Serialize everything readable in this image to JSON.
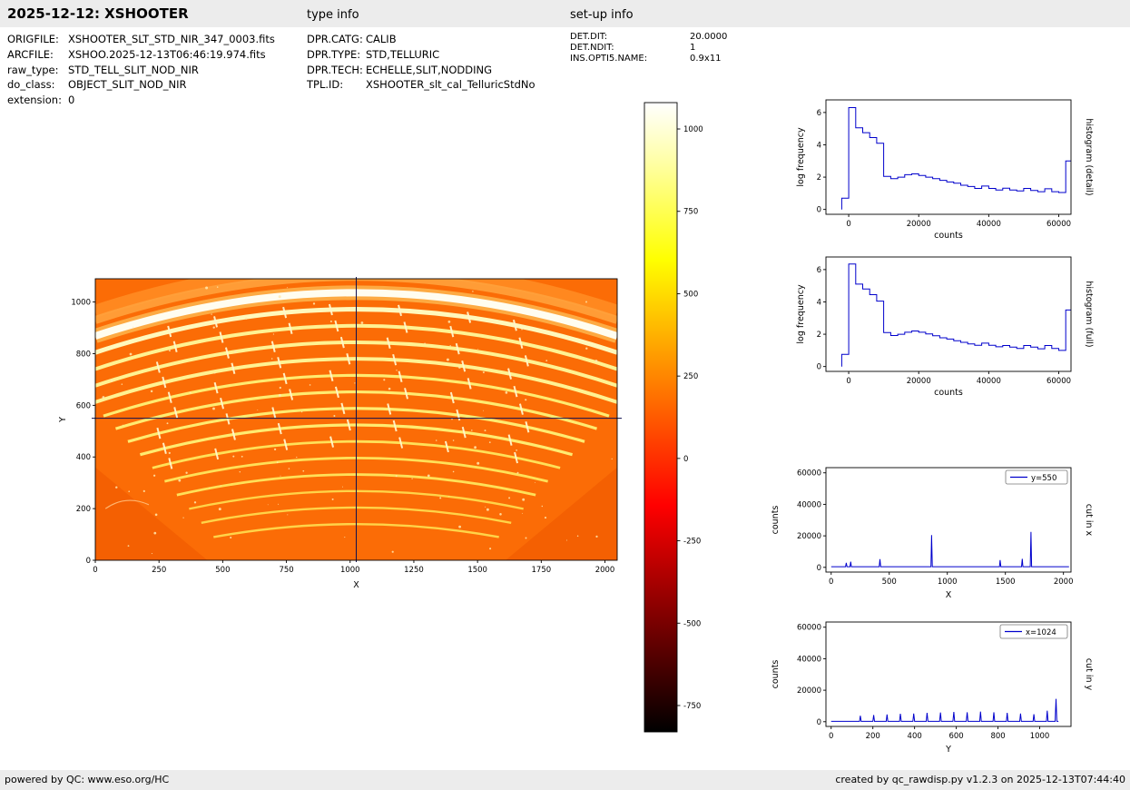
{
  "header": {
    "title": "2025-12-12: XSHOOTER",
    "type_info_label": "type info",
    "setup_info_label": "set-up info"
  },
  "file_info": [
    {
      "key": "ORIGFILE:",
      "value": "XSHOOTER_SLT_STD_NIR_347_0003.fits"
    },
    {
      "key": "ARCFILE:",
      "value": "XSHOO.2025-12-13T06:46:19.974.fits"
    },
    {
      "key": "raw_type:",
      "value": "STD_TELL_SLIT_NOD_NIR"
    },
    {
      "key": "do_class:",
      "value": "OBJECT_SLIT_NOD_NIR"
    },
    {
      "key": "extension:",
      "value": "0"
    }
  ],
  "type_info": [
    {
      "key": "DPR.CATG:",
      "value": "CALIB"
    },
    {
      "key": "DPR.TYPE:",
      "value": "STD,TELLURIC"
    },
    {
      "key": "DPR.TECH:",
      "value": "ECHELLE,SLIT,NODDING"
    },
    {
      "key": "TPL.ID:",
      "value": "XSHOOTER_slt_cal_TelluricStdNo"
    }
  ],
  "setup_info": [
    {
      "key": "DET.DIT:",
      "value": "20.0000"
    },
    {
      "key": "DET.NDIT:",
      "value": "1"
    },
    {
      "key": "INS.OPTI5.NAME:",
      "value": "0.9x11"
    }
  ],
  "footer": {
    "left": "powered by QC: www.eso.org/HC",
    "right": "created by qc_rawdisp.py v1.2.3 on 2025-12-13T07:44:40"
  },
  "chart_data": [
    {
      "id": "raw_frame",
      "type": "heatmap",
      "description": "XSHOOTER NIR raw echelle frame: ~15 bright curved spectral orders on orange background, hot colormap, crosshair marking cut positions",
      "xlabel": "X",
      "ylabel": "Y",
      "xlim": [
        0,
        2048
      ],
      "ylim": [
        0,
        1090
      ],
      "xticks": [
        0,
        250,
        500,
        750,
        1000,
        1250,
        1500,
        1750,
        2000
      ],
      "yticks": [
        0,
        200,
        400,
        600,
        800,
        1000
      ],
      "colormap": "hot",
      "crosshair": {
        "x": 1024,
        "y": 550
      },
      "image": {
        "background": "#fb6c06",
        "corner_shade": "#f05a00",
        "orders": {
          "count": 15,
          "peak_y_start": 140,
          "peak_y_step": 64,
          "halfspan_start": 560,
          "halfspan_step": 48,
          "curvature": 0.00016
        }
      },
      "colorbar": {
        "ticks": [
          1000,
          750,
          500,
          250,
          0,
          -250,
          -500,
          -750
        ],
        "vmin": -830,
        "vmax": 1080,
        "gradient_top_to_bottom": [
          [
            "0%",
            "#ffffff"
          ],
          [
            "10%",
            "#ffffa0"
          ],
          [
            "25%",
            "#ffff00"
          ],
          [
            "45%",
            "#ff7c00"
          ],
          [
            "55%",
            "#ff3900"
          ],
          [
            "64%",
            "#ff0000"
          ],
          [
            "80%",
            "#8c0000"
          ],
          [
            "92%",
            "#380000"
          ],
          [
            "100%",
            "#000000"
          ]
        ]
      }
    },
    {
      "id": "hist_detail",
      "type": "line",
      "subtype": "step-histogram",
      "xlabel": "counts",
      "ylabel": "log frequency",
      "right_label": "histogram (detail)",
      "xlim": [
        -6500,
        63500
      ],
      "ylim": [
        -0.3,
        6.78
      ],
      "xticks": [
        0,
        20000,
        40000,
        60000
      ],
      "yticks": [
        0,
        2,
        4,
        6
      ],
      "line_color": "#0000cc",
      "bin_start": -2000,
      "bin_width": 2000,
      "values": [
        0.7,
        6.3,
        5.05,
        4.75,
        4.45,
        4.1,
        2.05,
        1.9,
        2.0,
        2.15,
        2.2,
        2.1,
        2.0,
        1.9,
        1.8,
        1.7,
        1.62,
        1.5,
        1.42,
        1.3,
        1.45,
        1.3,
        1.2,
        1.32,
        1.2,
        1.15,
        1.3,
        1.18,
        1.1,
        1.28,
        1.1,
        1.05,
        3.0
      ]
    },
    {
      "id": "hist_full",
      "type": "line",
      "subtype": "step-histogram",
      "xlabel": "counts",
      "ylabel": "log frequency",
      "right_label": "histogram (full)",
      "xlim": [
        -6500,
        63500
      ],
      "ylim": [
        -0.3,
        6.78
      ],
      "xticks": [
        0,
        20000,
        40000,
        60000
      ],
      "yticks": [
        0,
        2,
        4,
        6
      ],
      "line_color": "#0000cc",
      "bin_start": -2000,
      "bin_width": 2000,
      "values": [
        0.75,
        6.35,
        5.1,
        4.8,
        4.45,
        4.05,
        2.1,
        1.92,
        2.0,
        2.12,
        2.2,
        2.12,
        2.02,
        1.9,
        1.78,
        1.7,
        1.6,
        1.5,
        1.4,
        1.32,
        1.45,
        1.32,
        1.22,
        1.3,
        1.2,
        1.12,
        1.3,
        1.2,
        1.1,
        1.3,
        1.12,
        1.0,
        3.5
      ]
    },
    {
      "id": "cut_x",
      "type": "line",
      "subtype": "spikes",
      "legend": "y=550",
      "xlabel": "X",
      "ylabel": "counts",
      "right_label": "cut in x",
      "xlim": [
        -45,
        2065
      ],
      "ylim": [
        -3000,
        63300
      ],
      "xticks": [
        0,
        500,
        1000,
        1500,
        2000
      ],
      "yticks": [
        0,
        20000,
        40000,
        60000
      ],
      "line_color": "#0000cc",
      "baseline": 400,
      "xrange": [
        0,
        2048
      ],
      "spike_halfwidth": 6,
      "spikes": [
        [
          130,
          2800
        ],
        [
          168,
          3600
        ],
        [
          420,
          5200
        ],
        [
          865,
          20500
        ],
        [
          1455,
          4600
        ],
        [
          1645,
          5400
        ],
        [
          1720,
          22500
        ]
      ]
    },
    {
      "id": "cut_y",
      "type": "line",
      "subtype": "spikes",
      "legend": "x=1024",
      "xlabel": "Y",
      "ylabel": "counts",
      "right_label": "cut in y",
      "xlim": [
        -25,
        1150
      ],
      "ylim": [
        -3000,
        63300
      ],
      "xticks": [
        0,
        200,
        400,
        600,
        800,
        1000
      ],
      "yticks": [
        0,
        20000,
        40000,
        60000
      ],
      "line_color": "#0000cc",
      "baseline": 250,
      "xrange": [
        0,
        1090
      ],
      "spike_halfwidth": 4,
      "spikes": [
        [
          140,
          3800
        ],
        [
          204,
          4200
        ],
        [
          268,
          4600
        ],
        [
          332,
          5000
        ],
        [
          396,
          5200
        ],
        [
          460,
          5600
        ],
        [
          524,
          5800
        ],
        [
          588,
          6200
        ],
        [
          652,
          6000
        ],
        [
          716,
          6400
        ],
        [
          780,
          6000
        ],
        [
          844,
          5600
        ],
        [
          908,
          5200
        ],
        [
          972,
          4800
        ],
        [
          1036,
          7000
        ],
        [
          1078,
          14500
        ]
      ]
    }
  ]
}
